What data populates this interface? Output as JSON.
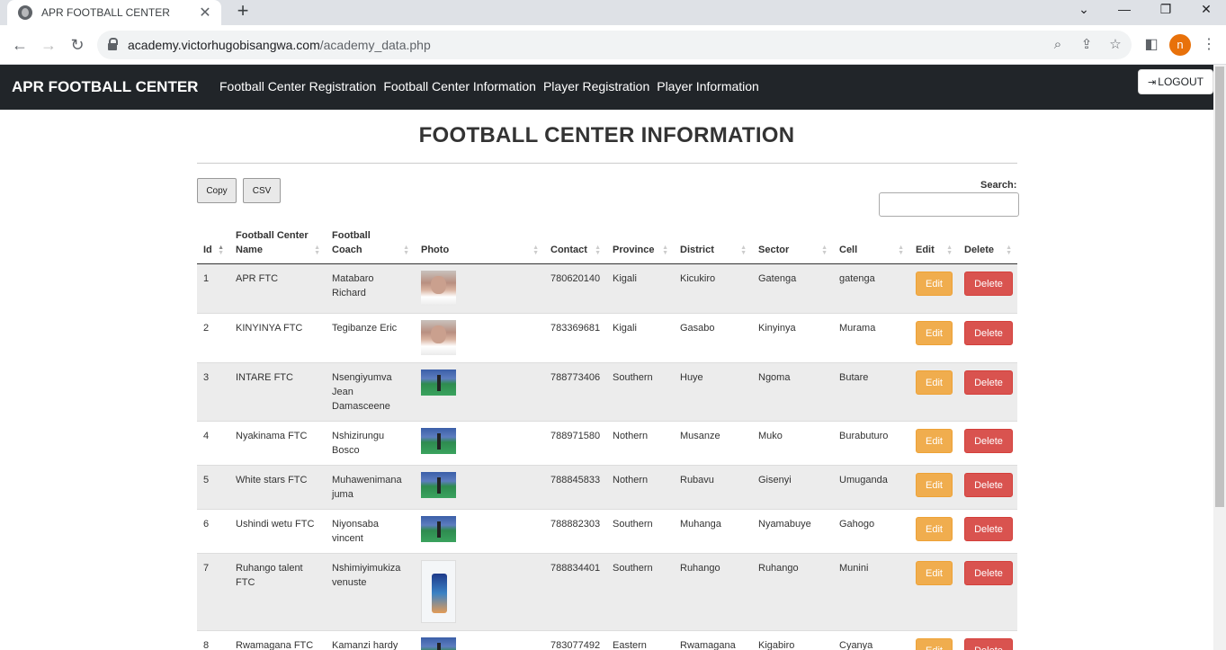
{
  "browser": {
    "tab_title": "APR FOOTBALL CENTER",
    "url_host": "academy.victorhugobisangwa.com",
    "url_path": "/academy_data.php",
    "profile_initial": "n"
  },
  "navbar": {
    "brand": "APR FOOTBALL CENTER",
    "links": [
      "Football Center Registration",
      "Football Center Information",
      "Player Registration",
      "Player Information"
    ],
    "logout_label": "LOGOUT"
  },
  "page": {
    "title": "FOOTBALL CENTER INFORMATION",
    "copy_label": "Copy",
    "csv_label": "CSV",
    "search_label": "Search:",
    "search_value": ""
  },
  "table": {
    "headers": {
      "id": "Id",
      "name": "Football Center Name",
      "coach": "Football Coach",
      "photo": "Photo",
      "contact": "Contact",
      "province": "Province",
      "district": "District",
      "sector": "Sector",
      "cell": "Cell",
      "edit": "Edit",
      "delete": "Delete"
    },
    "edit_label": "Edit",
    "delete_label": "Delete",
    "rows": [
      {
        "id": "1",
        "name": "APR FTC",
        "coach": "Matabaro Richard",
        "photo": "face",
        "contact": "780620140",
        "province": "Kigali",
        "district": "Kicukiro",
        "sector": "Gatenga",
        "cell": "gatenga"
      },
      {
        "id": "2",
        "name": "KINYINYA FTC",
        "coach": "Tegibanze Eric",
        "photo": "face",
        "contact": "783369681",
        "province": "Kigali",
        "district": "Gasabo",
        "sector": "Kinyinya",
        "cell": "Murama"
      },
      {
        "id": "3",
        "name": "INTARE FTC",
        "coach": "Nsengiyumva Jean Damasceene",
        "photo": "field",
        "contact": "788773406",
        "province": "Southern",
        "district": "Huye",
        "sector": "Ngoma",
        "cell": "Butare"
      },
      {
        "id": "4",
        "name": "Nyakinama FTC",
        "coach": "Nshizirungu Bosco",
        "photo": "field",
        "contact": "788971580",
        "province": "Nothern",
        "district": "Musanze",
        "sector": "Muko",
        "cell": "Burabuturo"
      },
      {
        "id": "5",
        "name": "White stars FTC",
        "coach": "Muhawenimana juma",
        "photo": "field",
        "contact": "788845833",
        "province": "Nothern",
        "district": "Rubavu",
        "sector": "Gisenyi",
        "cell": "Umuganda"
      },
      {
        "id": "6",
        "name": "Ushindi wetu FTC",
        "coach": "Niyonsaba vincent",
        "photo": "field",
        "contact": "788882303",
        "province": "Southern",
        "district": "Muhanga",
        "sector": "Nyamabuye",
        "cell": "Gahogo"
      },
      {
        "id": "7",
        "name": "Ruhango talent FTC",
        "coach": "Nshimiyimukiza venuste",
        "photo": "phone",
        "contact": "788834401",
        "province": "Southern",
        "district": "Ruhango",
        "sector": "Ruhango",
        "cell": "Munini"
      },
      {
        "id": "8",
        "name": "Rwamagana FTC",
        "coach": "Kamanzi hardy",
        "photo": "field",
        "contact": "783077492",
        "province": "Eastern",
        "district": "Rwamagana",
        "sector": "Kigabiro",
        "cell": "Cyanya"
      }
    ]
  }
}
